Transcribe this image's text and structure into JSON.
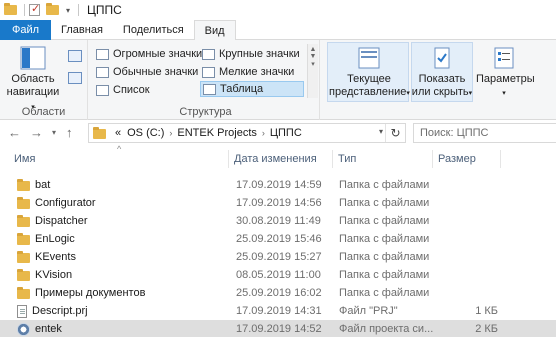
{
  "titlebar": {
    "title": "ЦППС"
  },
  "tabs": [
    {
      "label": "Файл"
    },
    {
      "label": "Главная"
    },
    {
      "label": "Поделиться"
    },
    {
      "label": "Вид"
    }
  ],
  "ribbon": {
    "panes": {
      "nav_pane_label_1": "Область",
      "nav_pane_label_2": "навигации",
      "group_title": "Области"
    },
    "layout": {
      "items": [
        {
          "label": "Огромные значки"
        },
        {
          "label": "Крупные значки"
        },
        {
          "label": "Обычные значки"
        },
        {
          "label": "Мелкие значки"
        },
        {
          "label": "Список"
        },
        {
          "label": "Таблица"
        }
      ],
      "group_title": "Структура"
    },
    "current_view": {
      "label_1": "Текущее",
      "label_2": "представление"
    },
    "show_hide": {
      "label_1": "Показать",
      "label_2": "или скрыть"
    },
    "options": {
      "label": "Параметры"
    }
  },
  "address": {
    "prefix": "«",
    "crumbs": [
      "OS (C:)",
      "ENTEK Projects",
      "ЦППС"
    ],
    "search_placeholder": "Поиск: ЦППС"
  },
  "columns": {
    "name": "Имя",
    "date": "Дата изменения",
    "type": "Тип",
    "size": "Размер"
  },
  "rows": [
    {
      "name": "bat",
      "date": "17.09.2019 14:59",
      "type": "Папка с файлами",
      "size": "",
      "icon": "folder-icon"
    },
    {
      "name": "Configurator",
      "date": "17.09.2019 14:56",
      "type": "Папка с файлами",
      "size": "",
      "icon": "folder-icon"
    },
    {
      "name": "Dispatcher",
      "date": "30.08.2019 11:49",
      "type": "Папка с файлами",
      "size": "",
      "icon": "folder-icon"
    },
    {
      "name": "EnLogic",
      "date": "25.09.2019 15:46",
      "type": "Папка с файлами",
      "size": "",
      "icon": "folder-icon"
    },
    {
      "name": "KEvents",
      "date": "25.09.2019 15:27",
      "type": "Папка с файлами",
      "size": "",
      "icon": "folder-icon"
    },
    {
      "name": "KVision",
      "date": "08.05.2019 11:00",
      "type": "Папка с файлами",
      "size": "",
      "icon": "folder-icon"
    },
    {
      "name": "Примеры документов",
      "date": "25.09.2019 16:02",
      "type": "Папка с файлами",
      "size": "",
      "icon": "folder-icon"
    },
    {
      "name": "Descript.prj",
      "date": "17.09.2019 14:31",
      "type": "Файл \"PRJ\"",
      "size": "1 КБ",
      "icon": "file-icon"
    },
    {
      "name": "entek",
      "date": "17.09.2019 14:52",
      "type": "Файл проекта си...",
      "size": "2 КБ",
      "icon": "project-file-icon",
      "selected": true
    }
  ]
}
